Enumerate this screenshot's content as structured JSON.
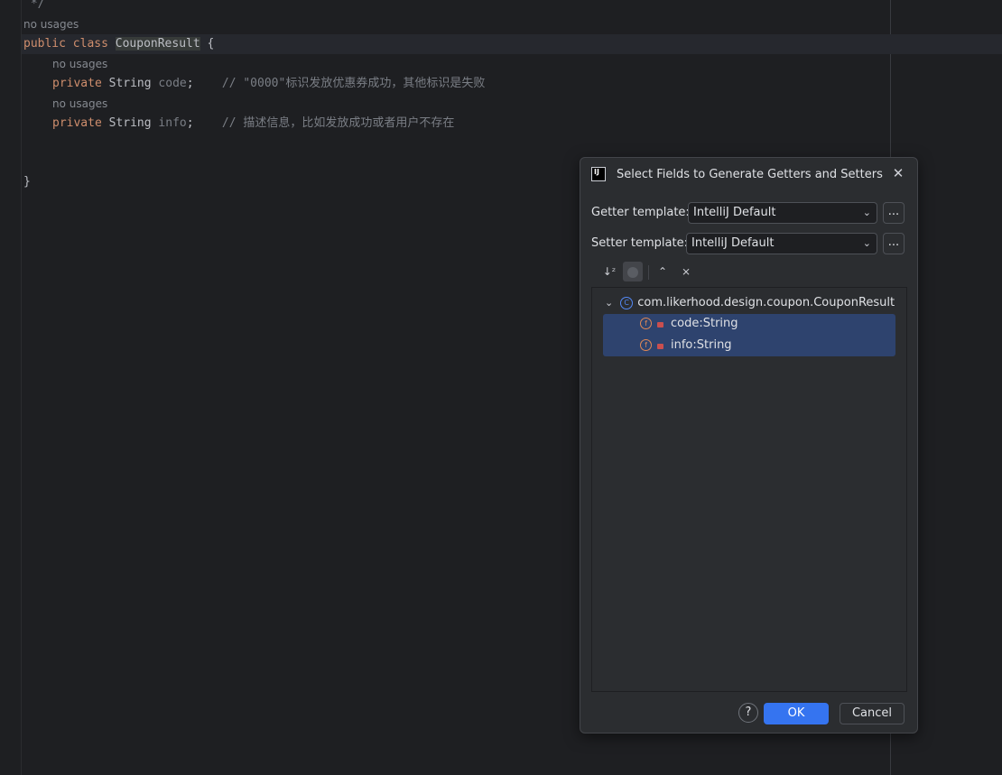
{
  "editor": {
    "comment_end": " */",
    "usage_hint_class": "no usages",
    "class_decl": {
      "kw_public": "public",
      "kw_class": "class",
      "class_name": "CouponResult",
      "brace_open": "{"
    },
    "field1": {
      "usage_hint": "no usages",
      "kw_private": "private",
      "type": "String",
      "name": "code",
      "semicolon": ";",
      "comment_prefix": "// ",
      "comment_string": "\"0000\"",
      "comment_text": "标识发放优惠券成功，其他标识是失败"
    },
    "field2": {
      "usage_hint": "no usages",
      "kw_private": "private",
      "type": "String",
      "name": "info",
      "semicolon": ";",
      "comment": "// 描述信息，比如发放成功或者用户不存在"
    },
    "brace_close": "}"
  },
  "dialog": {
    "title": "Select Fields to Generate Getters and Setters",
    "app_icon_text": "IJ",
    "getter": {
      "label": "Getter template:",
      "value": "IntelliJ Default"
    },
    "setter": {
      "label": "Setter template:",
      "value": "IntelliJ Default"
    },
    "browse_label": "...",
    "tree": {
      "root": "com.likerhood.design.coupon.CouponResult",
      "fields": [
        "code:String",
        "info:String"
      ]
    },
    "help_label": "?",
    "ok_label": "OK",
    "cancel_label": "Cancel"
  },
  "colors": {
    "accent": "#3574f0",
    "selection": "#2e436e",
    "keyword": "#cf8e6d"
  },
  "icons": {
    "close": "close-icon",
    "sort": "sort-alpha-icon",
    "expand": "expand-all-icon",
    "collapse": "collapse-all-icon",
    "field": "field-icon",
    "lock": "lock-icon",
    "class": "class-icon",
    "chevron": "chevron-down-icon"
  }
}
